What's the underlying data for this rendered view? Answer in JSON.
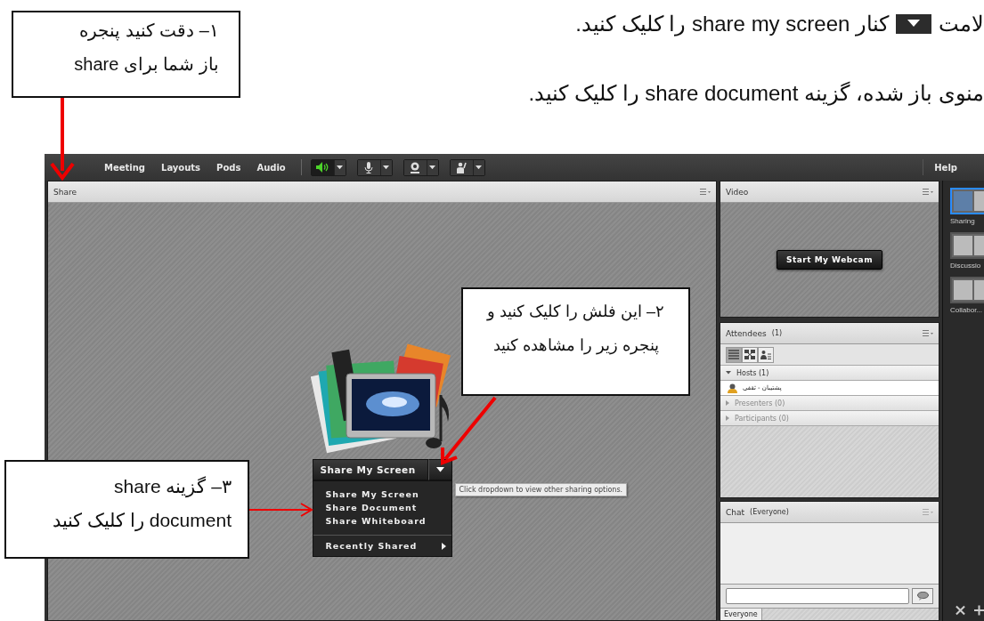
{
  "document": {
    "lines": [
      {
        "kind": "with-icon",
        "before": "لامت",
        "after": "کنار share  my screen  را کلیک کنید."
      },
      {
        "kind": "plain",
        "text": "منوی باز شده، گزینه share document را کلیک کنید."
      }
    ]
  },
  "callouts": [
    {
      "lines": [
        "۱– دقت کنید پنجره",
        "باز شما برای share"
      ]
    },
    {
      "lines": [
        "۲– این فلش را کلیک کنید و",
        "پنجره زیر را مشاهده کنید"
      ]
    },
    {
      "lines": [
        "۳– گزینه  share",
        "document را کلیک کنید"
      ]
    }
  ],
  "app": {
    "menu": [
      "Meeting",
      "Layouts",
      "Pods",
      "Audio"
    ],
    "help": "Help",
    "toolbar": [
      {
        "kind": "speaker",
        "on": true
      },
      {
        "kind": "mic",
        "on": false
      },
      {
        "kind": "camera",
        "on": false
      },
      {
        "kind": "hand",
        "on": false
      }
    ],
    "share_pod": {
      "title": "Share",
      "button": "Share My Screen",
      "menu_items": [
        "Share My Screen",
        "Share Document",
        "Share Whiteboard"
      ],
      "recent": "Recently Shared",
      "tooltip": "Click dropdown to view other sharing options."
    },
    "video_pod": {
      "title": "Video",
      "button": "Start My Webcam"
    },
    "attendees_pod": {
      "title": "Attendees",
      "count": "(1)",
      "views": [
        {
          "kind": "list",
          "selected": true
        },
        {
          "kind": "grid",
          "selected": false
        },
        {
          "kind": "detail",
          "selected": false
        }
      ],
      "groups": [
        {
          "label": "Hosts (1)",
          "expanded": true,
          "children": [
            {
              "name": "پشتیبان - ثقفی"
            }
          ]
        },
        {
          "label": "Presenters (0)",
          "expanded": false
        },
        {
          "label": "Participants (0)",
          "expanded": false
        }
      ]
    },
    "chat_pod": {
      "title": "Chat",
      "scope": "(Everyone)",
      "tab": "Everyone"
    },
    "layouts": [
      {
        "label": "Sharing",
        "selected": true
      },
      {
        "label": "Discussio",
        "selected": false
      },
      {
        "label": "Collabor...",
        "selected": false
      }
    ]
  }
}
